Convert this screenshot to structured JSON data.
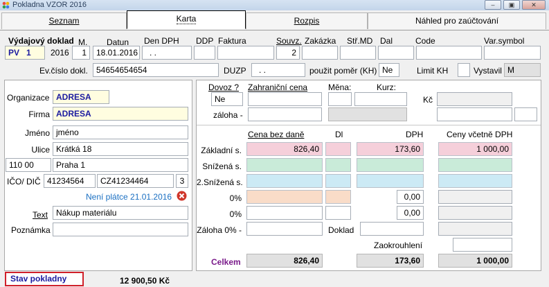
{
  "window": {
    "title": "Pokladna VZOR  2016",
    "min": "–",
    "max": "▣",
    "close": "✕"
  },
  "tabs": [
    {
      "label": "Seznam"
    },
    {
      "label": "Karta"
    },
    {
      "label": "Rozpis"
    },
    {
      "label": "Náhled pro zaúčtování"
    }
  ],
  "header": {
    "doc_label": "Výdajový doklad",
    "m_label": "M.",
    "datum_label": "Datun",
    "dendph_label": "Den DPH",
    "ddp_label": "DDP",
    "faktura_label": "Faktura",
    "souvz_label": "Souvz.",
    "zakazka_label": "Zakázka",
    "strmd_label": "Stř.MD",
    "dal_label": "Dal",
    "code_label": "Code",
    "varsym_label": "Var.symbol",
    "doc_type": "PV",
    "doc_num": "1",
    "year": "2016",
    "m_value": "1",
    "datum_value": "18.01.2016",
    "dendph_value": ". .",
    "ddp_value": "",
    "faktura_value": "",
    "souvz_value": "2",
    "zakazka_value": "",
    "strmd_value": "",
    "dal_value": "",
    "code_value": "",
    "varsym_value": "",
    "evcislo_label": "Ev.číslo dokl.",
    "evcislo_value": "54654654654",
    "duzp_label": "DUZP",
    "duzp_value": ". .",
    "pomer_label": "použit poměr (KH)",
    "pomer_value": "Ne",
    "limitkh_label": "Limit KH",
    "limitkh_value": "",
    "vystavil_label": "Vystavil",
    "vystavil_value": "M"
  },
  "left": {
    "organizace_label": "Organizace",
    "organizace_value": "ADRESA",
    "firma_label": "Firma",
    "firma_value": "ADRESA",
    "jmeno_label": "Jméno",
    "jmeno_value": "jméno",
    "ulice_label": "Ulice",
    "ulice_value": "Krátká 18",
    "psc_value": "110 00",
    "mesto_value": "Praha 1",
    "icodic_label": "IČO/ DIČ",
    "ico_value": "41234564",
    "dic_value": "CZ41234464",
    "dic_num": "3",
    "neplatce_text": "Není plátce 21.01.2016",
    "text_label": "Text",
    "text_value": "Nákup materiálu",
    "poznamka_label": "Poznámka",
    "poznamka_value": ""
  },
  "right": {
    "dovoz_label": "Dovoz ?",
    "dovoz_value": "Ne",
    "zahr_label": "Zahraniční cena",
    "mena_label": "Měna:",
    "kurz_label": "Kurz:",
    "kc_label": "Kč",
    "zaloha_label": "záloha -",
    "col_cena": "Cena bez daně",
    "col_dl": "Dl",
    "col_dph": "DPH",
    "col_ceny": "Ceny včetně DPH",
    "rows": [
      {
        "label": "Základní s.",
        "cena": "826,40",
        "dph": "173,60",
        "celkem": "1 000,00"
      },
      {
        "label": "Snížená s.",
        "cena": "",
        "dph": "",
        "celkem": ""
      },
      {
        "label": "2.Snížená s.",
        "cena": "",
        "dph": "",
        "celkem": ""
      },
      {
        "label": "0%",
        "cena": "",
        "dph": "0,00",
        "celkem": ""
      },
      {
        "label": "0%",
        "cena": "",
        "dph": "0,00",
        "celkem": ""
      }
    ],
    "zaloha0_label": "Záloha 0% -",
    "doklad_label": "Doklad",
    "zaokr_label": "Zaokrouhlení",
    "celkem_label": "Celkem",
    "celkem_cena": "826,40",
    "celkem_dph": "173,60",
    "celkem_total": "1 000,00"
  },
  "footer": {
    "stav_label": "Stav pokladny",
    "stav_value": "12 900,50 Kč"
  }
}
